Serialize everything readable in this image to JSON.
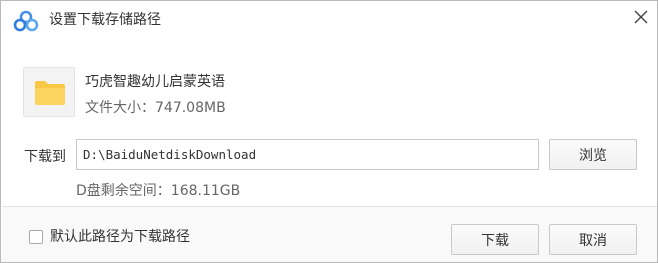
{
  "window": {
    "title": "设置下载存储路径",
    "app_icon": "baidu-netdisk-icon",
    "close_icon": "close-icon"
  },
  "file": {
    "icon": "folder-icon",
    "name": "巧虎智趣幼儿启蒙英语",
    "size_label": "文件大小：",
    "size_value": "747.08MB"
  },
  "download": {
    "label": "下载到",
    "path": "D:\\BaiduNetdiskDownload",
    "browse_label": "浏览",
    "free_space_label": "D盘剩余空间：",
    "free_space_value": "168.11GB"
  },
  "footer": {
    "default_path_label": "默认此路径为下载路径",
    "default_path_checked": false,
    "download_label": "下载",
    "cancel_label": "取消"
  },
  "colors": {
    "accent_blue": "#3b8de6",
    "folder_yellow": "#f9c846"
  }
}
